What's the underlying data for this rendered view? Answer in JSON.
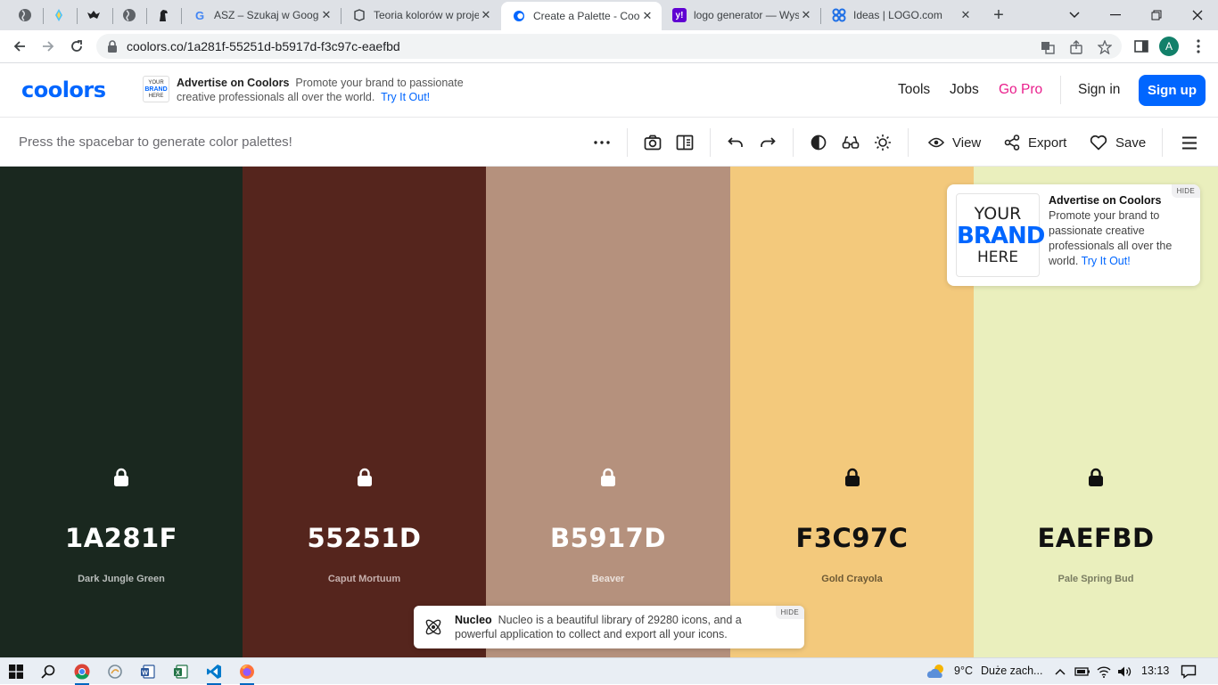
{
  "browser": {
    "pinned_tabs": [
      {
        "icon": "globe-icon"
      },
      {
        "icon": "extension-icon"
      },
      {
        "icon": "bat-icon"
      },
      {
        "icon": "globe-icon"
      },
      {
        "icon": "horse-icon"
      }
    ],
    "tabs": [
      {
        "title": "ASZ – Szukaj w Google",
        "icon": "google-icon",
        "close": "✕"
      },
      {
        "title": "Teoria kolorów w projektowaniu",
        "icon": "document-icon",
        "close": "✕"
      },
      {
        "title": "Create a Palette - Coolors",
        "icon": "coolors-icon",
        "close": "✕",
        "active": true
      },
      {
        "title": "logo generator — Wyszukiwanie",
        "icon": "yahoo-icon",
        "close": "✕"
      },
      {
        "title": "Ideas | LOGO.com",
        "icon": "logo-com-icon",
        "close": "✕"
      }
    ],
    "new_tab": "+",
    "url": "coolors.co/1a281f-55251d-b5917d-f3c97c-eaefbd",
    "profile_initial": "A"
  },
  "header": {
    "logo": "coolors",
    "ad_thumb": {
      "l1": "YOUR",
      "l2": "BRAND",
      "l3": "HERE"
    },
    "ad_title": "Advertise on Coolors",
    "ad_body": "Promote your brand to passionate creative professionals all over the world.",
    "ad_link": "Try It Out!",
    "nav": {
      "tools": "Tools",
      "jobs": "Jobs",
      "pro": "Go Pro",
      "signin": "Sign in",
      "signup": "Sign up"
    }
  },
  "generator_bar": {
    "hint": "Press the spacebar to generate color palettes!",
    "view": "View",
    "export": "Export",
    "save": "Save"
  },
  "palette": [
    {
      "hex": "1A281F",
      "name": "Dark Jungle Green",
      "color": "#1A281F",
      "text_color": "#ffffff",
      "name_color": "#b9bdbb",
      "locked_icon": "lock-icon"
    },
    {
      "hex": "55251D",
      "name": "Caput Mortuum",
      "color": "#55251D",
      "text_color": "#ffffff",
      "name_color": "#c6b0ad",
      "locked_icon": "lock-icon"
    },
    {
      "hex": "B5917D",
      "name": "Beaver",
      "color": "#B5917D",
      "text_color": "#ffffff",
      "name_color": "#ece2dc",
      "locked_icon": "lock-icon"
    },
    {
      "hex": "F3C97C",
      "name": "Gold Crayola",
      "color": "#F3C97C",
      "text_color": "#111111",
      "name_color": "#6e5a35",
      "locked_icon": "lock-icon"
    },
    {
      "hex": "EAEFBD",
      "name": "Pale Spring Bud",
      "color": "#EAEFBD",
      "text_color": "#111111",
      "name_color": "#7a7d62",
      "locked_icon": "lock-icon"
    }
  ],
  "ad_card": {
    "brand": {
      "l1": "YOUR",
      "l2": "BRAND",
      "l3": "HERE"
    },
    "title": "Advertise on Coolors",
    "body": "Promote your brand to passionate creative professionals all over the world.",
    "link": "Try It Out!",
    "hide": "HIDE"
  },
  "toast": {
    "title": "Nucleo",
    "body": "Nucleo is a beautiful library of 29280 icons, and a powerful application to collect and export all your icons.",
    "hide": "HIDE"
  },
  "taskbar": {
    "weather": "9°C",
    "weather_text": "Duże zach...",
    "time": "13:13"
  },
  "colors": {
    "accent": "#0066ff",
    "pro": "#e91e8c"
  }
}
